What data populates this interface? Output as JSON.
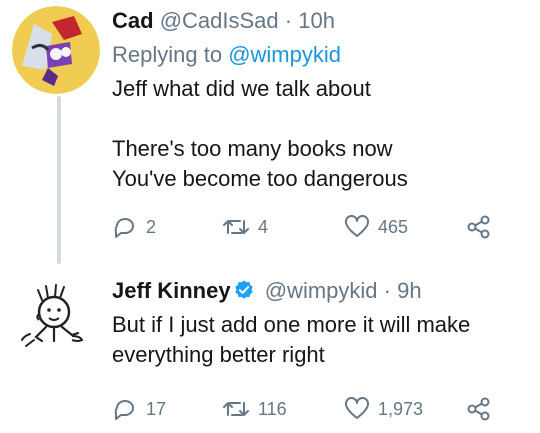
{
  "tweet1": {
    "name": "Cad",
    "handle": "@CadIsSad",
    "separator": "·",
    "time": "10h",
    "reply_prefix": "Replying to ",
    "reply_to": "@wimpykid",
    "lines_a": [
      "Jeff what did we talk about"
    ],
    "lines_b": [
      "There's too many books now",
      "You've become too dangerous"
    ],
    "replies": "2",
    "retweets": "4",
    "likes": "465"
  },
  "tweet2": {
    "name": "Jeff Kinney",
    "handle": "@wimpykid",
    "separator": "·",
    "time": "9h",
    "lines": [
      "But if I just add one more it will make",
      "everything better right"
    ],
    "replies": "17",
    "retweets": "116",
    "likes": "1,973"
  },
  "colors": {
    "text": "#14171a",
    "muted": "#657786",
    "link": "#1b95e0",
    "verified": "#1da1f2",
    "thread_line": "#d4d9dd"
  },
  "icons": [
    "reply-icon",
    "retweet-icon",
    "like-icon",
    "share-icon",
    "verified-icon"
  ]
}
